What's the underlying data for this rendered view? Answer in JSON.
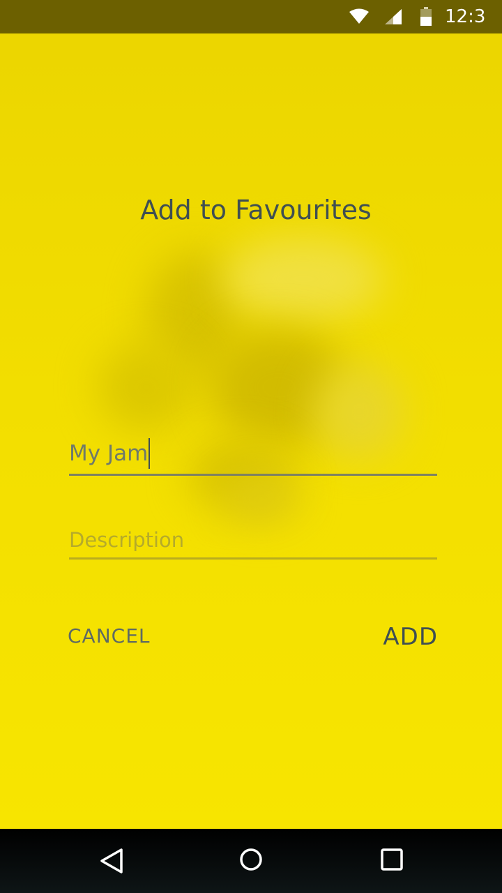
{
  "status_bar": {
    "time": "12:3",
    "icons": [
      "wifi-icon",
      "signal-icon",
      "battery-icon"
    ]
  },
  "dialog": {
    "title": "Add to Favourites",
    "name_field": {
      "value": "My Jam",
      "placeholder": ""
    },
    "description_field": {
      "value": "",
      "placeholder": "Description"
    },
    "cancel_label": "CANCEL",
    "add_label": "ADD"
  },
  "nav_bar": {
    "icons": [
      "back-icon",
      "home-icon",
      "recents-icon"
    ]
  },
  "colors": {
    "background": "#f3df00",
    "status_bar": "#6c6000",
    "text_primary": "#3f4f52",
    "text_secondary": "#6f7a6a",
    "nav_bar": "#000000"
  }
}
